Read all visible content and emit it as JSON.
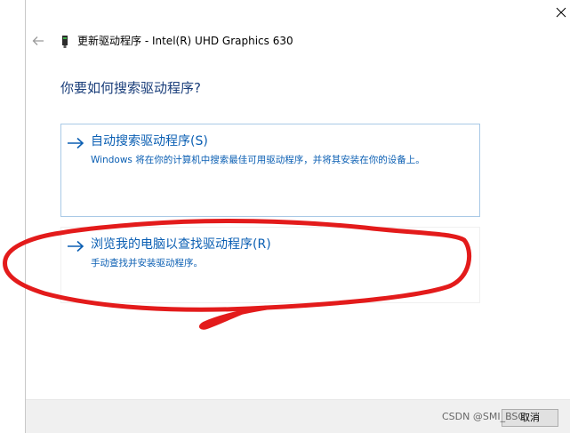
{
  "window": {
    "title": "更新驱动程序 - Intel(R) UHD Graphics 630"
  },
  "question": "你要如何搜索驱动程序?",
  "options": [
    {
      "title": "自动搜索驱动程序(S)",
      "description": "Windows 将在你的计算机中搜索最佳可用驱动程序，并将其安装在你的设备上。"
    },
    {
      "title": "浏览我的电脑以查找驱动程序(R)",
      "description": "手动查找并安装驱动程序。"
    }
  ],
  "footer": {
    "cancel_label": "取消"
  },
  "watermark": "CSDN @SMI_BSG",
  "icons": {
    "close": "close-icon",
    "back": "back-arrow-icon",
    "device": "device-icon",
    "option_arrow": "arrow-right-icon"
  },
  "colors": {
    "question": "#1a3e7a",
    "link": "#0b5fb3",
    "selected_border": "#a9c9e6",
    "annotation": "#e31b1b"
  }
}
